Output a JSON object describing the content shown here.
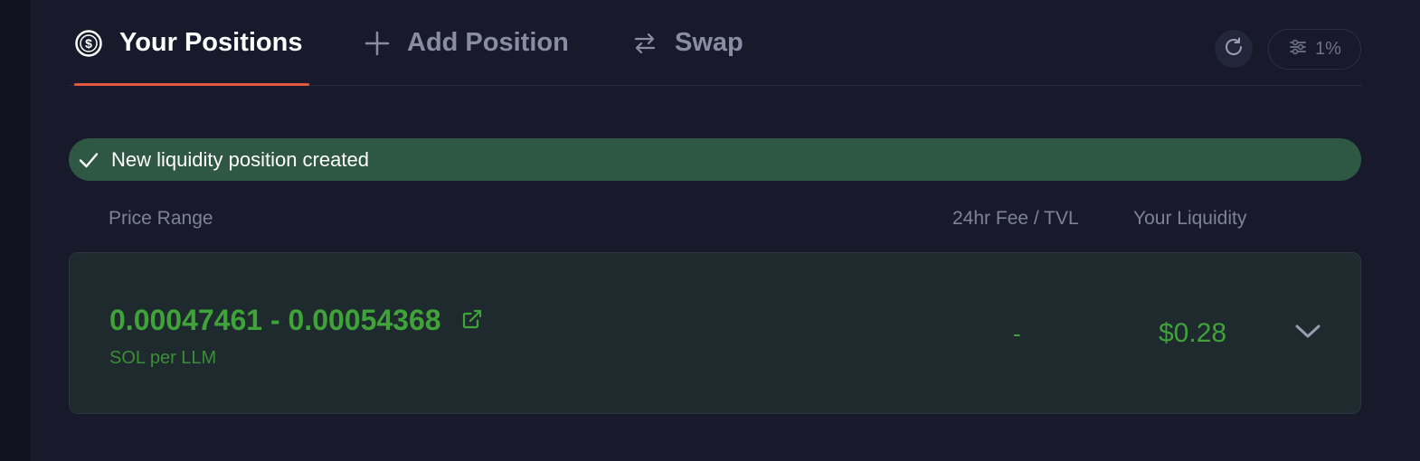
{
  "tabs": {
    "positions": {
      "label": "Your Positions",
      "icon": "dollar-circle-icon"
    },
    "add": {
      "label": "Add Position",
      "icon": "plus-icon"
    },
    "swap": {
      "label": "Swap",
      "icon": "swap-arrows-icon"
    }
  },
  "toolbar": {
    "refresh_icon": "refresh-icon",
    "slippage_icon": "sliders-icon",
    "slippage_label": "1%"
  },
  "banner": {
    "message": "New liquidity position created",
    "icon": "check-icon"
  },
  "table": {
    "headers": {
      "price_range": "Price Range",
      "fee_tvl": "24hr Fee / TVL",
      "liquidity": "Your Liquidity"
    },
    "rows": [
      {
        "price_range": "0.00047461 - 0.00054368",
        "unit": "SOL per LLM",
        "fee_tvl": "-",
        "liquidity": "$0.28"
      }
    ]
  },
  "colors": {
    "accent_underline": "#e5583f",
    "success_banner": "#2e5844",
    "value_green": "#3fa33a"
  }
}
